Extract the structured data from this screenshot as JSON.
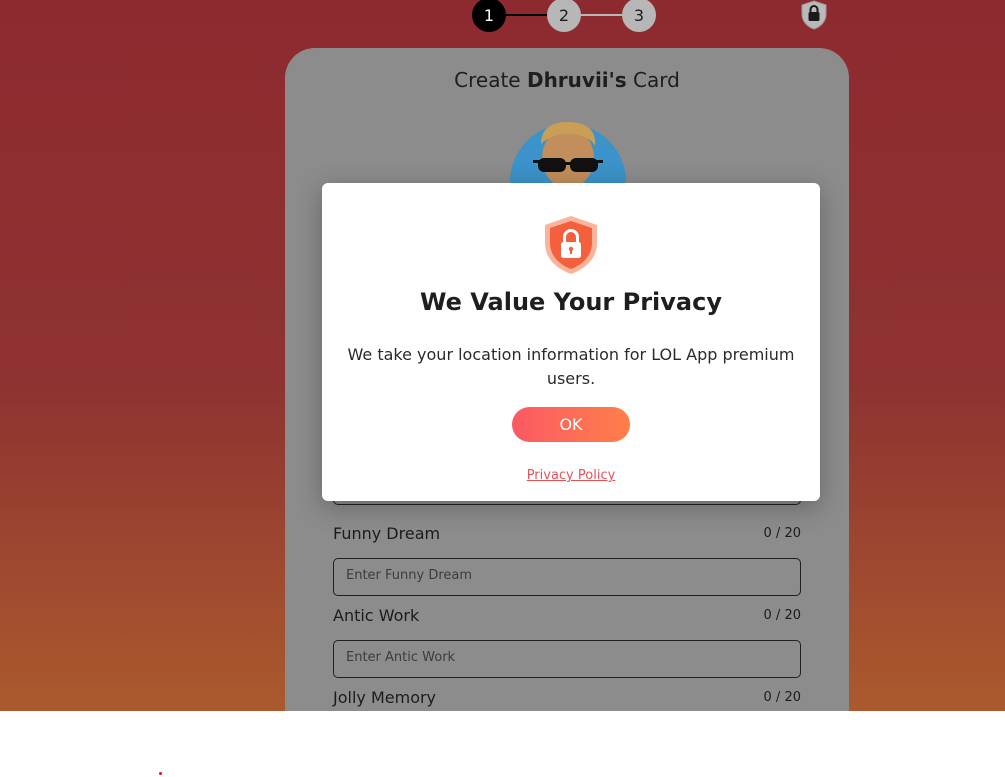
{
  "stepper": {
    "steps": [
      "1",
      "2",
      "3"
    ],
    "active_step": 1
  },
  "card": {
    "title_prefix": "Create",
    "title_name": "Dhruvii's",
    "title_suffix": "Card",
    "fields": [
      {
        "label": "Funny Dream",
        "count": "0 / 20",
        "placeholder": "Enter Funny Dream"
      },
      {
        "label": "Antic Work",
        "count": "0 / 20",
        "placeholder": "Enter Antic Work"
      },
      {
        "label": "Jolly Memory",
        "count": "0 / 20"
      }
    ]
  },
  "modal": {
    "icon": "shield-lock-icon",
    "title": "We Value Your Privacy",
    "body": "We take your location information for LOL App premium users.",
    "ok_label": "OK",
    "privacy_link": "Privacy Policy"
  },
  "colors": {
    "background_top": "#8d2a30",
    "background_bottom": "#ab5a2e",
    "accent_start": "#fb5964",
    "accent_end": "#fe7f49",
    "link": "#e4515a"
  }
}
